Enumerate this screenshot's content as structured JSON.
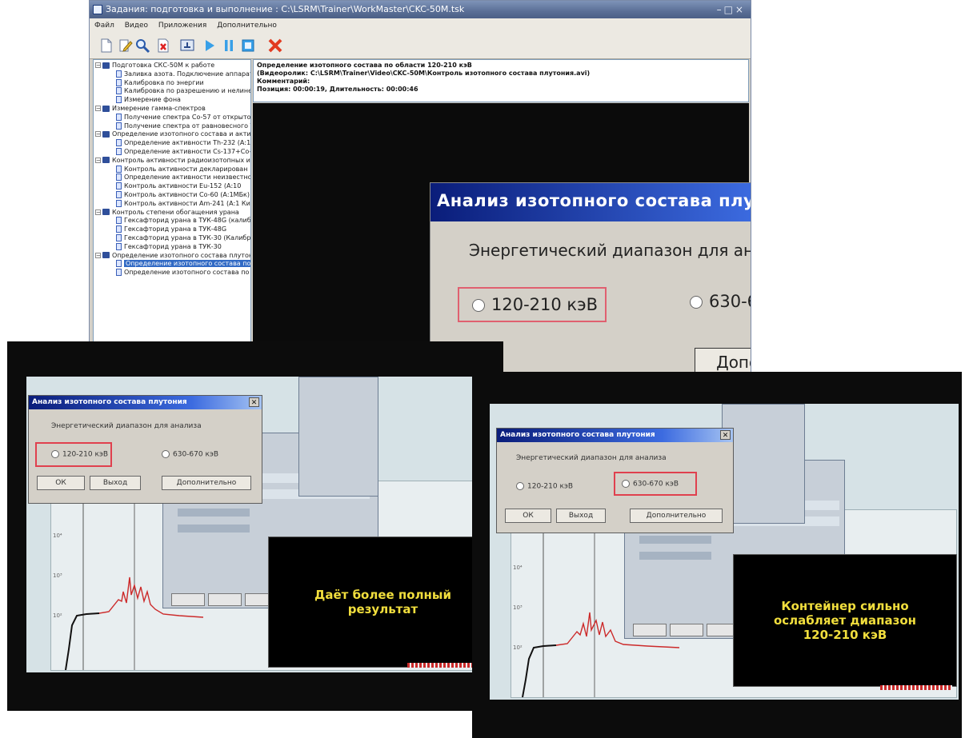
{
  "app": {
    "title": "Задания: подготовка и выполнение : C:\\LSRM\\Trainer\\WorkMaster\\CKC-50M.tsk",
    "window_controls": "–□×",
    "menu": [
      "Файл",
      "Видео",
      "Приложения",
      "Дополнительно"
    ],
    "toolbar_icons": [
      "new-file-icon",
      "edit-icon",
      "search-icon",
      "delete-icon",
      "export-icon",
      "play-icon",
      "pause-icon",
      "stop-icon",
      "close-icon"
    ]
  },
  "tree": [
    {
      "level": 0,
      "type": "folder",
      "label": "Подготовка СКС-50М к работе"
    },
    {
      "level": 1,
      "type": "doc",
      "label": "Заливка азота. Подключение аппарат"
    },
    {
      "level": 1,
      "type": "doc",
      "label": "Калибровка по энергии"
    },
    {
      "level": 1,
      "type": "doc",
      "label": "Калибровка по разрешению и нелине"
    },
    {
      "level": 1,
      "type": "doc",
      "label": "Измерение фона"
    },
    {
      "level": 0,
      "type": "folder",
      "label": "Измерение гамма-спектров"
    },
    {
      "level": 1,
      "type": "doc",
      "label": "Получение спектра Co-57 от открытог"
    },
    {
      "level": 1,
      "type": "doc",
      "label": "Получение спектра от равновесного Т"
    },
    {
      "level": 0,
      "type": "folder",
      "label": "Определение изотопного состава и актив"
    },
    {
      "level": 1,
      "type": "doc",
      "label": "Определение активности Th-232 (А:1"
    },
    {
      "level": 1,
      "type": "doc",
      "label": "Определение активности Cs-137+Co-6"
    },
    {
      "level": 0,
      "type": "folder",
      "label": "Контроль активности радиоизотопных ис"
    },
    {
      "level": 1,
      "type": "doc",
      "label": "Контроль активности декларирован"
    },
    {
      "level": 1,
      "type": "doc",
      "label": "Определение активности неизвестно"
    },
    {
      "level": 1,
      "type": "doc",
      "label": "Контроль активности Eu-152 (А:10"
    },
    {
      "level": 1,
      "type": "doc",
      "label": "Контроль активности Co-60 (А:1МБк)"
    },
    {
      "level": 1,
      "type": "doc",
      "label": "Контроль активности Am-241 (А:1 Ки)"
    },
    {
      "level": 0,
      "type": "folder",
      "label": "Контроль степени обогащения урана"
    },
    {
      "level": 1,
      "type": "doc",
      "label": "Гексафторид урана в ТУК-48G (калиб"
    },
    {
      "level": 1,
      "type": "doc",
      "label": "Гексафторид урана в ТУК-48G"
    },
    {
      "level": 1,
      "type": "doc",
      "label": "Гексафторид урана в ТУК-30 (Калибр"
    },
    {
      "level": 1,
      "type": "doc",
      "label": "Гексафторид урана в ТУК-30"
    },
    {
      "level": 0,
      "type": "folder",
      "label": "Определение изотопного состава плутони"
    },
    {
      "level": 1,
      "type": "doc",
      "label": "Определение изотопного состава по о",
      "selected": true
    },
    {
      "level": 1,
      "type": "doc",
      "label": "Определение изотопного состава по"
    }
  ],
  "info": {
    "line1": "Определение изотопного состава по области 120-210 кэВ",
    "line2": "(Видеоролик: C:\\LSRM\\Trainer\\Video\\CKC-50M\\Контроль изотопного состава плутония.avi)",
    "line3": "Комментарий:",
    "line4": "Позиция: 00:00:19, Длительность: 00:00:46"
  },
  "dialog": {
    "title": "Анализ изотопного состава плутония",
    "close": "✕",
    "range_label": "Энергетический диапазон для анализа",
    "option1": "120-210 кэВ",
    "option2": "630-670 кэВ",
    "ok": "ОК",
    "exit": "Выход",
    "advanced": "Дополнительно"
  },
  "captions": {
    "frame1": "Даёт более полный результат",
    "frame2": "Контейнер сильно ослабляет диапазон 120-210 кэВ"
  },
  "colors": {
    "highlight": "#e0404e",
    "caption_text": "#f1de3d",
    "title_gradient_start": "#0a1d7a",
    "spectrum_line": "#cc2a2a"
  }
}
